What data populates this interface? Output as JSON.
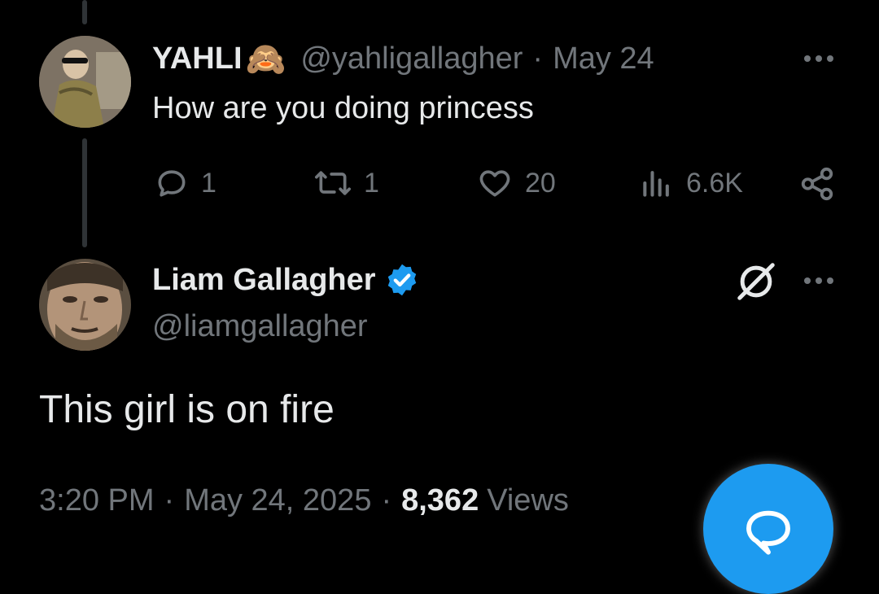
{
  "reply": {
    "display_name": "YAHLI",
    "emoji": "🙈",
    "handle": "@yahligallagher",
    "separator": "·",
    "date": "May 24",
    "text": "How are you doing princess",
    "stats": {
      "replies": "1",
      "reposts": "1",
      "likes": "20",
      "views": "6.6K"
    }
  },
  "main_post": {
    "display_name": "Liam Gallagher",
    "handle": "@liamgallagher",
    "verified_color": "#1d9bf0",
    "text": "This girl is on fire",
    "time": "3:20 PM",
    "sep1": "·",
    "date": "May 24, 2025",
    "sep2": "·",
    "views_count": "8,362",
    "views_label": "Views"
  },
  "icons": {
    "reply": "reply-icon",
    "repost": "repost-icon",
    "like": "heart-icon",
    "views": "analytics-icon",
    "share": "share-icon",
    "more": "more-icon",
    "grok": "grok-icon",
    "fab": "compose-reply-icon"
  }
}
